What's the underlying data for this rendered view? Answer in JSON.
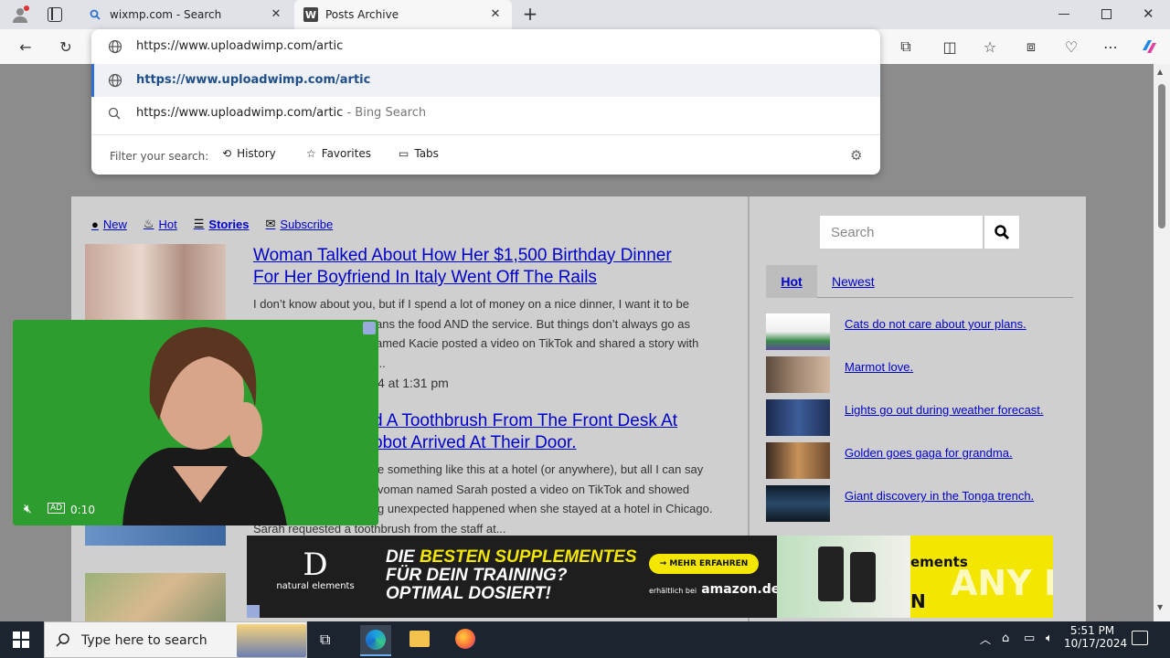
{
  "browser": {
    "tabs": [
      {
        "title": "wixmp.com - Search"
      },
      {
        "title": "Posts Archive",
        "favicon_letter": "W"
      }
    ],
    "address": "https://www.uploadwimp.com/artic",
    "omnibox": {
      "suggestion_1": "https://www.uploadwimp.com/artic",
      "suggestion_2": "https://www.uploadwimp.com/artic",
      "suggestion_2_hint": "- Bing Search",
      "filter_label": "Filter your search:",
      "filters": [
        "History",
        "Favorites",
        "Tabs"
      ]
    }
  },
  "page": {
    "nav": {
      "new": "New",
      "hot": "Hot",
      "stories": "Stories",
      "subscribe": "Subscribe"
    },
    "stories": [
      {
        "title_line1": "Woman Talked About How Her $1,500 Birthday Dinner",
        "title_line2": "For Her Boyfriend In Italy Went Off The Rails",
        "body_line1": "I don’t know about you, but if I spend a lot of money on a nice dinner, I want it to be",
        "body_line2": "ans the food AND the service. But things don’t always go as",
        "body_line3": "amed Kacie posted a video on TikTok and shared a story with",
        "body_line4": "...",
        "date": "4 at 1:31 pm"
      },
      {
        "title_line1": "d A Toothbrush From The Front Desk At",
        "title_line2": "obot Arrived At Their Door.",
        "body_line1": "e something like this at a hotel (or anywhere), but all I can say",
        "body_line2": "voman named Sarah posted a video on TikTok and showed",
        "body_line3": "g unexpected happened when she stayed at a hotel in Chicago.",
        "body_line4": "Sarah requested a toothbrush from the staff at..."
      }
    ],
    "sidebar": {
      "search_placeholder": "Search",
      "tabs": {
        "hot": "Hot",
        "newest": "Newest"
      },
      "items": [
        {
          "label": "Cats do not care about your plans."
        },
        {
          "label": "Marmot love."
        },
        {
          "label": "Lights go out during weather forecast."
        },
        {
          "label": "Golden goes gaga for grandma."
        },
        {
          "label": "Giant discovery in the Tonga trench."
        }
      ]
    },
    "video_ad": {
      "time": "0:10",
      "ad_badge": "AD"
    },
    "banner": {
      "brand": "natural elements",
      "headline_1a": "DIE ",
      "headline_1b": "BESTEN SUPPLEMENTES",
      "headline_2": "FÜR DEIN TRAINING?",
      "headline_3": "OPTIMAL DOSIERT!",
      "cta": "→ MEHR ERFAHREN",
      "store_prefix": "erhältlich bei",
      "store": "amazon.de",
      "right_partial_1": "ements",
      "right_partial_2": "N",
      "watermark": "ANY RUN"
    }
  },
  "taskbar": {
    "search_placeholder": "Type here to search",
    "time": "5:51 PM",
    "date": "10/17/2024"
  },
  "colors": {
    "link": "#0000cc",
    "accent": "#2c6ed5"
  }
}
